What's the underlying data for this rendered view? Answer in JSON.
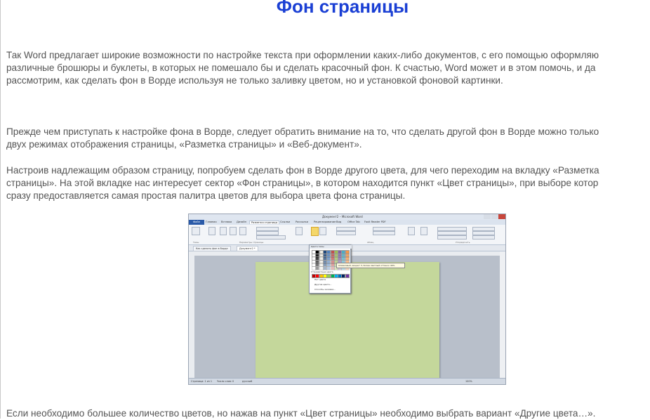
{
  "article": {
    "title": "Фон страницы",
    "paragraphs": [
      {
        "lines": [
          "Так Word предлагает широкие возможности по настройке текста при оформлении каких-либо документов, с его помощью оформляю",
          "различные брошюры и буклеты, в которых не помешало бы и сделать красочный фон. К счастью, Word может и в этом помочь, и да",
          "рассмотрим, как сделать фон в Ворде используя не только заливку цветом, но и установкой фоновой картинки."
        ]
      },
      {
        "lines": [
          "Прежде чем приступать к настройке фона в Ворде, следует обратить внимание на то, что сделать другой фон в Ворде можно только",
          "двух режимах отображения страницы, «Разметка страницы» и «Веб-документ»."
        ]
      },
      {
        "lines": [
          "Настроив надлежащим образом страницу, попробуем сделать фон в Ворде другого цвета, для чего переходим на вкладку «Разметка",
          "страницы». На этой вкладке нас интересует сектор «Фон страницы», в котором находится пункт «Цвет страницы», при выборе котор",
          "сразу предоставляется самая простая палитра цветов для выбора цвета фона страницы."
        ]
      },
      {
        "lines": [
          "Если необходимо большее количество цветов, но нажав на пункт «Цвет страницы» необходимо выбрать вариант «Другие цвета…»."
        ]
      }
    ]
  },
  "screenshot": {
    "window_title": "Документ2 – Microsoft Word",
    "ribbon_tabs": [
      {
        "label": "Файл",
        "active": false
      },
      {
        "label": "Главная",
        "active": false
      },
      {
        "label": "Вставка",
        "active": false
      },
      {
        "label": "Дизайн",
        "active": false
      },
      {
        "label": "Разметка страницы",
        "active": true
      },
      {
        "label": "Ссылки",
        "active": false
      },
      {
        "label": "Рассылки",
        "active": false
      },
      {
        "label": "Рецензирование",
        "active": false
      },
      {
        "label": "Вид",
        "active": false
      },
      {
        "label": "Office Tab",
        "active": false
      },
      {
        "label": "Foxit Reader PDF",
        "active": false
      }
    ],
    "ribbon_groups": [
      "Темы",
      "Параметры страницы",
      "Абзац",
      "Упорядочить"
    ],
    "doc_tabs": [
      "Как сделать фон в Ворде",
      "Документ2 *"
    ],
    "palette": {
      "header": "Цвета темы",
      "standard_label": "Стандартные цвета",
      "items": [
        "Нет цвета",
        "Другие цвета...",
        "Способы заливки..."
      ],
      "tooltip": "Оливковый, акцент 3, более светлый оттенок 40%",
      "theme_colors": [
        "#ffffff",
        "#000000",
        "#eeece1",
        "#1f497d",
        "#4f81bd",
        "#c0504d",
        "#9bbb59",
        "#8064a2",
        "#4bacc6",
        "#f79646"
      ],
      "standard_colors": [
        "#c00000",
        "#ff0000",
        "#ffc000",
        "#ffff00",
        "#92d050",
        "#00b050",
        "#00b0f0",
        "#0070c0",
        "#002060",
        "#7030a0"
      ]
    },
    "page_color": "#c4d79b",
    "status": {
      "page": "Страница: 1 из 1",
      "words": "Число слов: 0",
      "lang": "русский",
      "zoom": "100%"
    }
  },
  "colors": {
    "title": "#1a3fd4",
    "text": "#545454"
  }
}
